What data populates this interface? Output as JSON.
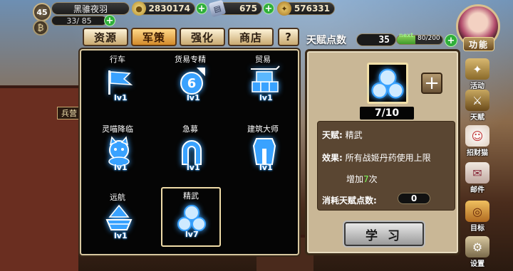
{
  "player": {
    "level": "45",
    "name": "黑骓夜羽",
    "stamina": "33/ 85"
  },
  "resources": [
    {
      "name": "gold",
      "value": "2830174"
    },
    {
      "name": "paper",
      "value": "675"
    },
    {
      "name": "currency3",
      "value": "576331"
    }
  ],
  "side_labels": {
    "barracks": "兵营"
  },
  "tabs": [
    {
      "label": "资源",
      "active": false
    },
    {
      "label": "军策",
      "active": true
    },
    {
      "label": "强化",
      "active": false
    },
    {
      "label": "商店",
      "active": false
    },
    {
      "label": "?",
      "active": false
    }
  ],
  "talents": [
    {
      "name": "行车",
      "level": "lv1",
      "icon": "flag-icon",
      "selected": false
    },
    {
      "name": "货易专精",
      "level": "lv1",
      "icon": "six-arrow-icon",
      "selected": false
    },
    {
      "name": "贸易",
      "level": "lv1",
      "icon": "crates-icon",
      "selected": false
    },
    {
      "name": "灵喵降临",
      "level": "lv1",
      "icon": "cat-icon",
      "selected": false
    },
    {
      "name": "急募",
      "level": "lv1",
      "icon": "horseshoe-icon",
      "selected": false
    },
    {
      "name": "建筑大师",
      "level": "lv1",
      "icon": "tower-icon",
      "selected": false
    },
    {
      "name": "远航",
      "level": "lv1",
      "icon": "ship-icon",
      "selected": false
    },
    {
      "name": "精武",
      "level": "lv7",
      "icon": "pills-icon",
      "selected": true
    }
  ],
  "talent_points": {
    "label": "天赋点数",
    "value": "35",
    "next_label": "next",
    "next_value": "80/200",
    "next_progress": 0.4
  },
  "detail": {
    "level": "7/10",
    "talent_label": "天赋:",
    "talent_name": "精武",
    "effect_label": "效果:",
    "effect_line1": "所有战姬丹药使用上限",
    "effect_prefix": "增加",
    "effect_number": "7",
    "effect_suffix": "次",
    "cost_label": "消耗天赋点数:",
    "cost_value": "0",
    "learn_label": "学 习"
  },
  "side_menu": {
    "function_label": "功能",
    "items": [
      {
        "label": "活动",
        "icon": "activity-icon"
      },
      {
        "label": "天赋",
        "icon": "talent-icon"
      },
      {
        "label": "招财猫",
        "icon": "lucky-cat-icon"
      },
      {
        "label": "邮件",
        "icon": "mail-icon"
      },
      {
        "label": "目标",
        "icon": "target-icon"
      },
      {
        "label": "设置",
        "icon": "gear-icon"
      }
    ]
  },
  "colors": {
    "accent_blue": "#39a2ff",
    "tab_active": "#ffd98a",
    "panel_bg": "#c9b796"
  }
}
